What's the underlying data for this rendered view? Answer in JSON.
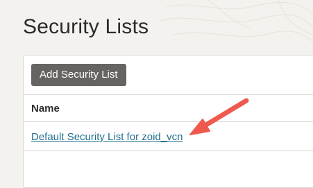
{
  "page": {
    "title": "Security Lists"
  },
  "toolbar": {
    "add_label": "Add Security List"
  },
  "table": {
    "columns": [
      "Name"
    ],
    "rows": [
      {
        "name": "Default Security List for zoid_vcn"
      }
    ]
  },
  "colors": {
    "button_bg": "#676361",
    "link": "#1f6e8c",
    "annotation_arrow": "#ee5a4f"
  }
}
